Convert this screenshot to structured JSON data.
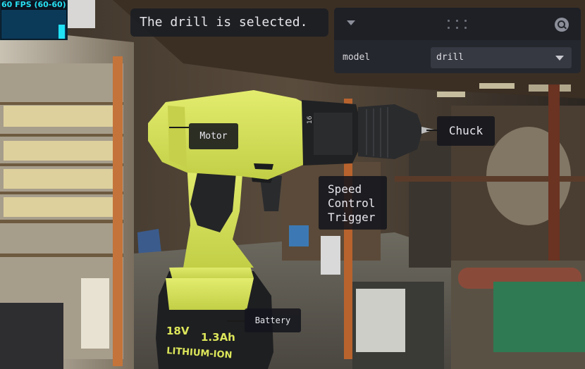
{
  "fps_meter": {
    "text": "60 FPS (60-60)",
    "current_fps": 60,
    "min_fps": 60,
    "max_fps": 60
  },
  "status_message": "The drill is selected.",
  "controls": {
    "model_label": "model",
    "model_value": "drill"
  },
  "annotations": {
    "motor": "Motor",
    "chuck": "Chuck",
    "trigger": [
      "Speed",
      "Control",
      "Trigger"
    ],
    "battery": "Battery"
  },
  "drill_print": {
    "battery_voltage": "18V",
    "battery_capacity": "1.3Ah",
    "battery_type": "LITHIUM-ION",
    "clutch_number": "16"
  },
  "colors": {
    "drill_body": "#d6e25a",
    "drill_dark": "#1c1d1f",
    "fps_text": "#27e0f2",
    "panel_bg": "#25272e",
    "label_bg": "#16181e"
  },
  "icons": {
    "collapse": "chevron-down-icon",
    "drag": "drag-handle-icon",
    "search": "search-icon",
    "select_caret": "caret-down-icon"
  }
}
